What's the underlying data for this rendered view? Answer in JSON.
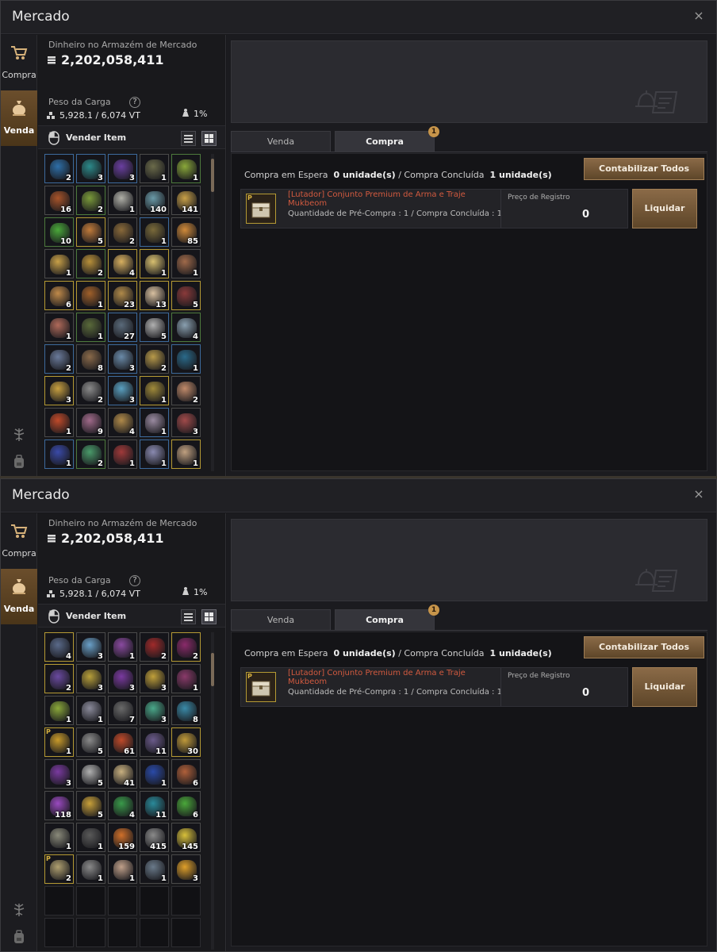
{
  "window_title": "Mercado",
  "close_glyph": "×",
  "nav": {
    "buy_label": "Compra",
    "sell_label": "Venda"
  },
  "money": {
    "label": "Dinheiro no Armazém de Mercado",
    "value": "2,202,058,411"
  },
  "weight": {
    "label": "Peso da Carga",
    "help": "?",
    "value": "5,928.1 / 6,074 VT",
    "percent": "1%"
  },
  "sell_item_label": "Vender Item",
  "tabs": {
    "sell": "Venda",
    "buy": "Compra",
    "badge": "1"
  },
  "status": {
    "waiting_label": "Compra em Espera",
    "waiting_value": "0 unidade(s)",
    "divider": "/",
    "done_label": "Compra Concluída",
    "done_value": "1 unidade(s)"
  },
  "settle_all_label": "Contabilizar Todos",
  "order": {
    "name": "[Lutador] Conjunto Premium de Arma e Traje Mukbeom",
    "qty": "Quantidade de Pré-Compra : 1 / Compra Concluída : 1",
    "price_label": "Preço de Registro",
    "price": "0",
    "p_tag": "P"
  },
  "liquidate_label": "Liquidar",
  "colors": {
    "accent_brown": "#7a5a38",
    "item_name_red": "#d25a3f",
    "quality_blue": "#3d6a9c",
    "quality_yellow": "#b59a34"
  },
  "inventory_top": [
    {
      "c": "2",
      "q": "blue",
      "col": "#2e6fa8"
    },
    {
      "c": "3",
      "q": "blue",
      "col": "#2c8a8a"
    },
    {
      "c": "3",
      "q": "blue",
      "col": "#6a3fa0"
    },
    {
      "c": "1",
      "q": "gray",
      "col": "#6b6b4a"
    },
    {
      "c": "1",
      "q": "green",
      "col": "#8aa83a"
    },
    {
      "c": "16",
      "q": "gray",
      "col": "#a8542a"
    },
    {
      "c": "2",
      "q": "green",
      "col": "#7a9a3a"
    },
    {
      "c": "1",
      "q": "gray",
      "col": "#b0b0a8"
    },
    {
      "c": "140",
      "q": "gray",
      "col": "#6a9aa8"
    },
    {
      "c": "141",
      "q": "gray",
      "col": "#c8a048"
    },
    {
      "c": "10",
      "q": "green",
      "col": "#4aa83a"
    },
    {
      "c": "5",
      "q": "yellow",
      "col": "#c07a3a"
    },
    {
      "c": "2",
      "q": "gray",
      "col": "#8a6a3a"
    },
    {
      "c": "1",
      "q": "blue",
      "col": "#7a6a3a"
    },
    {
      "c": "85",
      "q": "gray",
      "col": "#d08a3a"
    },
    {
      "c": "1",
      "q": "gray",
      "col": "#c8a048"
    },
    {
      "c": "2",
      "q": "green",
      "col": "#b8903a"
    },
    {
      "c": "4",
      "q": "yellow",
      "col": "#d8b060"
    },
    {
      "c": "1",
      "q": "yellow",
      "col": "#d8c070"
    },
    {
      "c": "1",
      "q": "gray",
      "col": "#a06a4a"
    },
    {
      "c": "6",
      "q": "yellow",
      "col": "#c08a4a"
    },
    {
      "c": "1",
      "q": "yellow",
      "col": "#a0602a"
    },
    {
      "c": "23",
      "q": "yellow",
      "col": "#b08a4a"
    },
    {
      "c": "13",
      "q": "yellow",
      "col": "#d8c0a0"
    },
    {
      "c": "5",
      "q": "yellow",
      "col": "#8a3a3a"
    },
    {
      "c": "1",
      "q": "gray",
      "col": "#b06a5a"
    },
    {
      "c": "1",
      "q": "green",
      "col": "#5a6a3a"
    },
    {
      "c": "27",
      "q": "blue",
      "col": "#5a6a7a"
    },
    {
      "c": "5",
      "q": "blue",
      "col": "#b0b0b0"
    },
    {
      "c": "4",
      "q": "green",
      "col": "#8aa0b0"
    },
    {
      "c": "2",
      "q": "blue",
      "col": "#6a7a9a"
    },
    {
      "c": "8",
      "q": "gray",
      "col": "#8a6a4a"
    },
    {
      "c": "3",
      "q": "blue",
      "col": "#6a8aa8"
    },
    {
      "c": "2",
      "q": "gray",
      "col": "#b89a4a"
    },
    {
      "c": "1",
      "q": "blue",
      "col": "#2a6a8a"
    },
    {
      "c": "3",
      "q": "yellow",
      "col": "#c8a040"
    },
    {
      "c": "2",
      "q": "gray",
      "col": "#8a8a8a"
    },
    {
      "c": "3",
      "q": "blue",
      "col": "#5aa0c0"
    },
    {
      "c": "1",
      "q": "yellow",
      "col": "#a08a3a"
    },
    {
      "c": "2",
      "q": "gray",
      "col": "#c08a6a"
    },
    {
      "c": "1",
      "q": "gray",
      "col": "#c04a2a"
    },
    {
      "c": "9",
      "q": "gray",
      "col": "#a06a8a"
    },
    {
      "c": "4",
      "q": "gray",
      "col": "#b08a4a"
    },
    {
      "c": "1",
      "q": "blue",
      "col": "#9a8aa0"
    },
    {
      "c": "3",
      "q": "gray",
      "col": "#a04a4a"
    },
    {
      "c": "1",
      "q": "blue",
      "col": "#3a4aa8"
    },
    {
      "c": "2",
      "q": "green",
      "col": "#4a9a6a"
    },
    {
      "c": "1",
      "q": "gray",
      "col": "#a03a3a"
    },
    {
      "c": "1",
      "q": "blue",
      "col": "#8a8ab0"
    },
    {
      "c": "1",
      "q": "yellow",
      "col": "#c0a080"
    }
  ],
  "inventory_bottom": [
    {
      "c": "4",
      "q": "yellow",
      "col": "#5a6a8a"
    },
    {
      "c": "3",
      "q": "gray",
      "col": "#6aa0c8"
    },
    {
      "c": "1",
      "q": "gray",
      "col": "#8a4aa0"
    },
    {
      "c": "2",
      "q": "gray",
      "col": "#a02a2a"
    },
    {
      "c": "2",
      "q": "yellow",
      "col": "#8a2a6a"
    },
    {
      "c": "2",
      "q": "yellow",
      "col": "#6a4aa0"
    },
    {
      "c": "3",
      "q": "gray",
      "col": "#b8a03a"
    },
    {
      "c": "3",
      "q": "gray",
      "col": "#7a3aa0"
    },
    {
      "c": "3",
      "q": "gray",
      "col": "#c0a03a"
    },
    {
      "c": "1",
      "q": "gray",
      "col": "#8a3a6a"
    },
    {
      "c": "1",
      "q": "gray",
      "col": "#8aa83a"
    },
    {
      "c": "1",
      "q": "gray",
      "col": "#8a8a9a"
    },
    {
      "c": "7",
      "q": "gray",
      "col": "#6a6a6a"
    },
    {
      "c": "3",
      "q": "gray",
      "col": "#4aa88a"
    },
    {
      "c": "8",
      "q": "gray",
      "col": "#3a8aa8"
    },
    {
      "c": "1",
      "q": "yellow",
      "col": "#c89a2a",
      "p": "P"
    },
    {
      "c": "5",
      "q": "gray",
      "col": "#8a8a8a"
    },
    {
      "c": "61",
      "q": "gray",
      "col": "#c04a2a"
    },
    {
      "c": "11",
      "q": "gray",
      "col": "#6a5a8a"
    },
    {
      "c": "30",
      "q": "yellow",
      "col": "#c09a3a"
    },
    {
      "c": "3",
      "q": "gray",
      "col": "#7a3aa0"
    },
    {
      "c": "5",
      "q": "gray",
      "col": "#b0b0b0"
    },
    {
      "c": "41",
      "q": "gray",
      "col": "#c8b080"
    },
    {
      "c": "1",
      "q": "gray",
      "col": "#2a4aa8"
    },
    {
      "c": "6",
      "q": "gray",
      "col": "#b0603a"
    },
    {
      "c": "118",
      "q": "gray",
      "col": "#9a4ac0"
    },
    {
      "c": "5",
      "q": "gray",
      "col": "#c8a03a"
    },
    {
      "c": "4",
      "q": "gray",
      "col": "#3a9a4a"
    },
    {
      "c": "11",
      "q": "gray",
      "col": "#2a8a9a"
    },
    {
      "c": "6",
      "q": "gray",
      "col": "#4aa83a"
    },
    {
      "c": "1",
      "q": "gray",
      "col": "#8a8a7a"
    },
    {
      "c": "1",
      "q": "gray",
      "col": "#5a5a5a"
    },
    {
      "c": "159",
      "q": "gray",
      "col": "#d0702a"
    },
    {
      "c": "415",
      "q": "gray",
      "col": "#8a8a8a"
    },
    {
      "c": "145",
      "q": "gray",
      "col": "#d8c03a"
    },
    {
      "c": "2",
      "q": "yellow",
      "col": "#b0a070",
      "p": "P"
    },
    {
      "c": "1",
      "q": "gray",
      "col": "#8a8a8a"
    },
    {
      "c": "1",
      "q": "gray",
      "col": "#c0a08a"
    },
    {
      "c": "1",
      "q": "gray",
      "col": "#6a7a8a"
    },
    {
      "c": "3",
      "q": "gray",
      "col": "#e0a02a"
    },
    {
      "c": "",
      "q": "empty",
      "col": ""
    },
    {
      "c": "",
      "q": "empty",
      "col": ""
    },
    {
      "c": "",
      "q": "empty",
      "col": ""
    },
    {
      "c": "",
      "q": "empty",
      "col": ""
    },
    {
      "c": "",
      "q": "empty",
      "col": ""
    },
    {
      "c": "",
      "q": "empty",
      "col": ""
    },
    {
      "c": "",
      "q": "empty",
      "col": ""
    },
    {
      "c": "",
      "q": "empty",
      "col": ""
    },
    {
      "c": "",
      "q": "empty",
      "col": ""
    },
    {
      "c": "",
      "q": "empty",
      "col": ""
    }
  ],
  "icons": [
    "cart-icon",
    "moneybag-icon",
    "tree-icon",
    "backpack-icon",
    "coin-icon",
    "scale-icon",
    "weight-icon",
    "mouse-icon",
    "list-view-icon",
    "grid-view-icon",
    "bell-scroll-icon",
    "chest-icon",
    "close-icon"
  ]
}
